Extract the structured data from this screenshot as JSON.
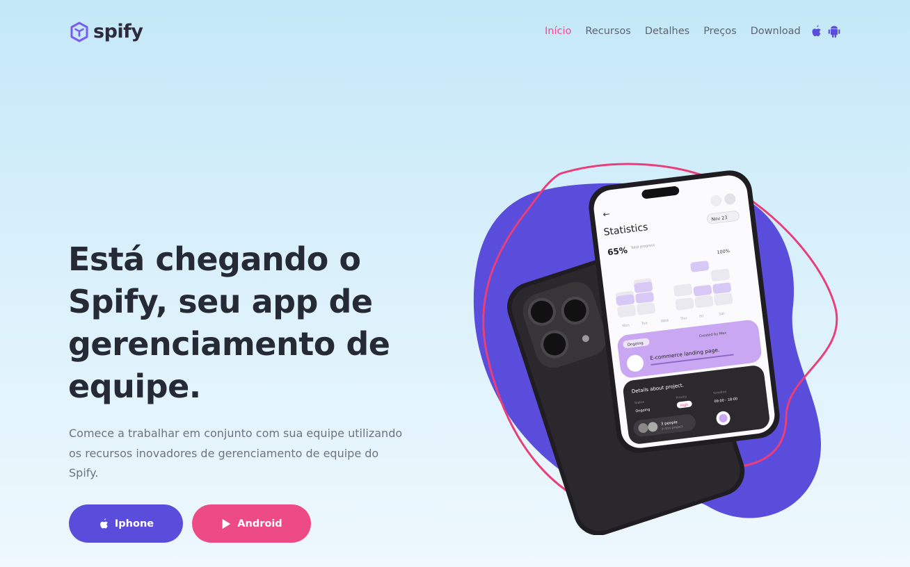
{
  "brand": {
    "name": "spify",
    "logo_icon": "box-icon",
    "color": "#7a5cf0"
  },
  "nav": {
    "links": [
      {
        "label": "Início",
        "active": true
      },
      {
        "label": "Recursos",
        "active": false
      },
      {
        "label": "Detalhes",
        "active": false
      },
      {
        "label": "Preços",
        "active": false
      },
      {
        "label": "Download",
        "active": false
      }
    ],
    "icons": [
      "apple-icon",
      "android-icon"
    ]
  },
  "hero": {
    "title": "Está chegando o Spify, seu app de gerenciamento de equipe.",
    "subtitle": "Comece a trabalhar em conjunto com sua equipe utilizando os recursos inovadores de gerenciamento de equipe do Spify.",
    "buttons": {
      "ios_label": "Iphone",
      "android_label": "Android"
    }
  },
  "phone_screen": {
    "title": "Statistics",
    "date_chip": "Nov 23",
    "progress_value": "65%",
    "progress_label": "Total progress",
    "peak_label": "100%",
    "days": [
      "Mon",
      "Tue",
      "Wed",
      "Thu",
      "Fri",
      "Sat"
    ],
    "status_chip": "Ongoing",
    "created_by": "Created by Max",
    "task_name": "E-commerce landing page.",
    "details_title": "Details about project.",
    "status_label": "Status",
    "status_value": "Ongoing",
    "priority_label": "Priority",
    "priority_value": "High",
    "timeline_label": "Timeline",
    "timeline_value": "09:00 - 18:00",
    "people": "3 people",
    "people_sub": "in this project"
  },
  "colors": {
    "accent_purple": "#5b4ddc",
    "accent_pink": "#ed4b85",
    "active_link": "#ed4b8e"
  }
}
